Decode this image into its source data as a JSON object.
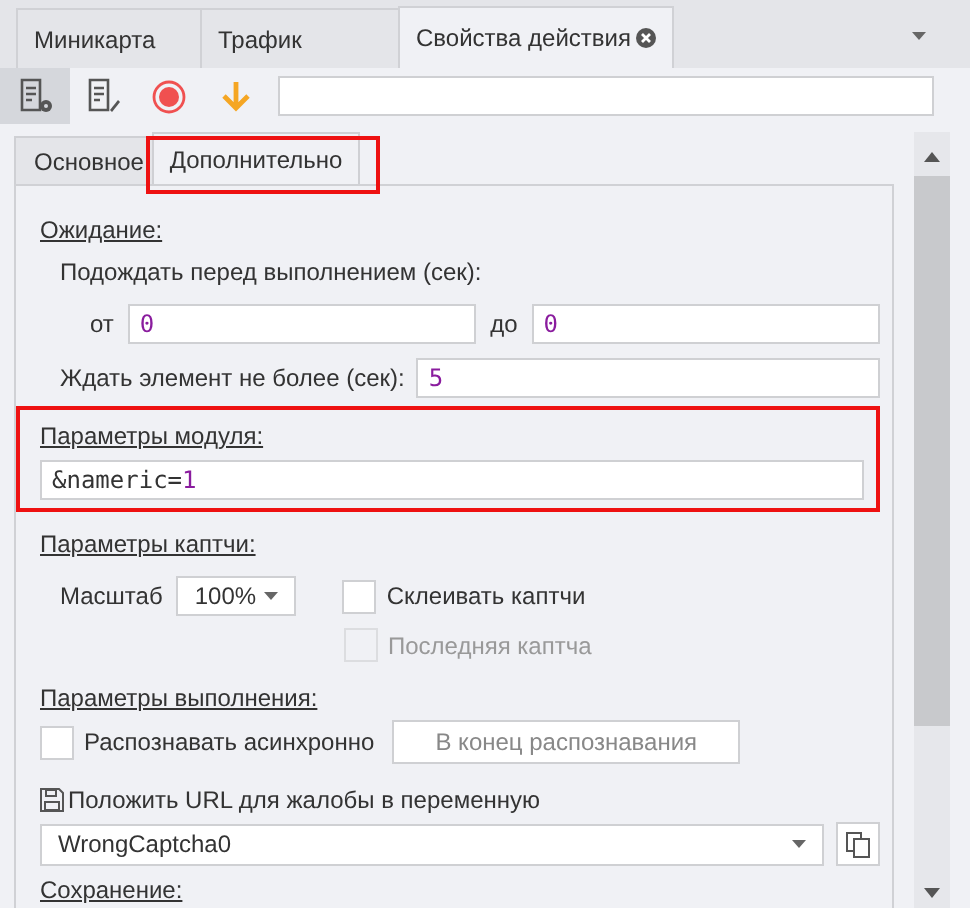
{
  "tabs": [
    {
      "label": "Миникарта",
      "selected": false,
      "closable": false
    },
    {
      "label": "Трафик",
      "selected": false,
      "closable": false
    },
    {
      "label": "Свойства действия",
      "selected": true,
      "closable": true
    }
  ],
  "toolbar": {
    "buttons": [
      {
        "kind": "properties",
        "selected": true
      },
      {
        "kind": "edit",
        "selected": false
      },
      {
        "kind": "record",
        "selected": false
      },
      {
        "kind": "download",
        "selected": false
      }
    ]
  },
  "subtabs": [
    {
      "label": "Основное",
      "selected": false,
      "highlighted": false
    },
    {
      "label": "Дополнительно",
      "selected": true,
      "highlighted": true
    }
  ],
  "wait": {
    "heading": "Ожидание:",
    "delay_label": "Подождать перед выполнением (сек):",
    "from_label": "от",
    "from_value": "0",
    "to_label": "до",
    "to_value": "0",
    "element_label": "Ждать элемент не более (сек):",
    "element_value": "5"
  },
  "module": {
    "heading": "Параметры модуля:",
    "highlighted": true,
    "value": [
      {
        "text": "&nameric=",
        "kind": "plain"
      },
      {
        "text": "1",
        "kind": "number"
      }
    ]
  },
  "captcha": {
    "heading": "Параметры каптчи:",
    "scale_label": "Масштаб",
    "scale_value": "100%",
    "glue": {
      "label": "Склеивать каптчи",
      "checked": false,
      "disabled": false
    },
    "last": {
      "label": "Последняя каптча",
      "checked": false,
      "disabled": true
    }
  },
  "execution": {
    "heading": "Параметры выполнения:",
    "async": {
      "label": "Распознавать асинхронно",
      "checked": false
    },
    "button": {
      "label": "В конец распознавания",
      "disabled": true
    }
  },
  "variable": {
    "label": "Положить URL для жалобы в переменную",
    "value": "WrongCaptcha0"
  },
  "saving": {
    "heading": "Сохранение:"
  }
}
